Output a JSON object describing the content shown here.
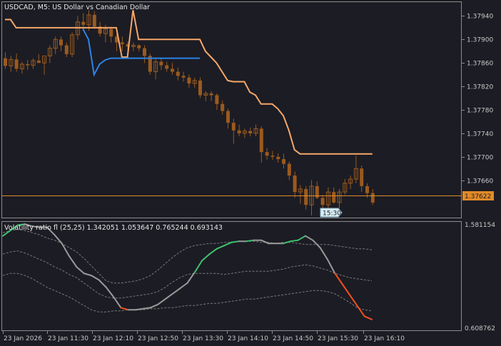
{
  "main_chart": {
    "title": "USDCAD, M5:  US Dollar vs Canadian Dollar",
    "price_labels": [
      "1.37940",
      "1.37900",
      "1.37860",
      "1.37820",
      "1.37780",
      "1.37740",
      "1.37700",
      "1.37660"
    ],
    "current_price": "1.37622",
    "time_tooltip": "15:30"
  },
  "indicator": {
    "title": "Volatility ratio fl (25,25) 1.342051 1.053647 0.765244 0.693143",
    "max_label": "1.581154",
    "min_label": "0.608762"
  },
  "time_axis": {
    "labels": [
      "23 Jan 2026",
      "23 Jan 11:30",
      "23 Jan 12:10",
      "23 Jan 12:50",
      "23 Jan 13:30",
      "23 Jan 14:10",
      "23 Jan 14:50",
      "23 Jan 15:30",
      "23 Jan 16:10"
    ]
  },
  "colors": {
    "background": "#1c1c24",
    "grid": "#5a5a5a",
    "candle": "#9a5a1e",
    "upper_line": "#f5a86a",
    "lower_line": "#2d83e6",
    "price_line": "#e08a28",
    "vol_up": "#3dc36e",
    "vol_down": "#f0501e",
    "vol_flat": "#9a9a9a",
    "vol_band": "#7a7a7a"
  },
  "chart_data": [
    {
      "type": "candlestick",
      "title": "USDCAD, M5:  US Dollar vs Canadian Dollar",
      "ylim": [
        1.376,
        1.3796
      ],
      "candles": [
        {
          "o": 1.37868,
          "h": 1.37878,
          "l": 1.3785,
          "c": 1.37855
        },
        {
          "o": 1.37855,
          "h": 1.37872,
          "l": 1.37845,
          "c": 1.37866
        },
        {
          "o": 1.37866,
          "h": 1.37876,
          "l": 1.37845,
          "c": 1.3785
        },
        {
          "o": 1.3785,
          "h": 1.37862,
          "l": 1.37842,
          "c": 1.37858
        },
        {
          "o": 1.37858,
          "h": 1.37865,
          "l": 1.37848,
          "c": 1.37856
        },
        {
          "o": 1.37856,
          "h": 1.37868,
          "l": 1.3785,
          "c": 1.37864
        },
        {
          "o": 1.37864,
          "h": 1.37875,
          "l": 1.3786,
          "c": 1.3786
        },
        {
          "o": 1.3786,
          "h": 1.3787,
          "l": 1.3784,
          "c": 1.37872
        },
        {
          "o": 1.37872,
          "h": 1.3789,
          "l": 1.3786,
          "c": 1.37885
        },
        {
          "o": 1.37885,
          "h": 1.37905,
          "l": 1.37875,
          "c": 1.379
        },
        {
          "o": 1.379,
          "h": 1.37905,
          "l": 1.3788,
          "c": 1.3789
        },
        {
          "o": 1.3789,
          "h": 1.37895,
          "l": 1.3787,
          "c": 1.37875
        },
        {
          "o": 1.37875,
          "h": 1.37912,
          "l": 1.3787,
          "c": 1.37908
        },
        {
          "o": 1.37908,
          "h": 1.3794,
          "l": 1.379,
          "c": 1.3793
        },
        {
          "o": 1.3793,
          "h": 1.37945,
          "l": 1.37915,
          "c": 1.37925
        },
        {
          "o": 1.37925,
          "h": 1.3795,
          "l": 1.37915,
          "c": 1.37942
        },
        {
          "o": 1.37942,
          "h": 1.37948,
          "l": 1.37918,
          "c": 1.37922
        },
        {
          "o": 1.37922,
          "h": 1.3793,
          "l": 1.37905,
          "c": 1.3791
        },
        {
          "o": 1.3791,
          "h": 1.37925,
          "l": 1.37895,
          "c": 1.37918
        },
        {
          "o": 1.37918,
          "h": 1.37922,
          "l": 1.37895,
          "c": 1.37905
        },
        {
          "o": 1.37905,
          "h": 1.3791,
          "l": 1.3788,
          "c": 1.37895
        },
        {
          "o": 1.37895,
          "h": 1.37905,
          "l": 1.3788,
          "c": 1.37892
        },
        {
          "o": 1.37892,
          "h": 1.37896,
          "l": 1.37878,
          "c": 1.37888
        },
        {
          "o": 1.37888,
          "h": 1.37895,
          "l": 1.3788,
          "c": 1.3789
        },
        {
          "o": 1.3789,
          "h": 1.37892,
          "l": 1.3788,
          "c": 1.37885
        },
        {
          "o": 1.37885,
          "h": 1.3789,
          "l": 1.3786,
          "c": 1.37872
        },
        {
          "o": 1.37872,
          "h": 1.37876,
          "l": 1.3784,
          "c": 1.37845
        },
        {
          "o": 1.37845,
          "h": 1.37868,
          "l": 1.37832,
          "c": 1.37862
        },
        {
          "o": 1.37862,
          "h": 1.37868,
          "l": 1.37848,
          "c": 1.37856
        },
        {
          "o": 1.37856,
          "h": 1.37862,
          "l": 1.37845,
          "c": 1.3785
        },
        {
          "o": 1.3785,
          "h": 1.3786,
          "l": 1.3784,
          "c": 1.37845
        },
        {
          "o": 1.37845,
          "h": 1.37852,
          "l": 1.3783,
          "c": 1.37838
        },
        {
          "o": 1.37838,
          "h": 1.37845,
          "l": 1.37828,
          "c": 1.37835
        },
        {
          "o": 1.37835,
          "h": 1.3784,
          "l": 1.37818,
          "c": 1.37825
        },
        {
          "o": 1.37825,
          "h": 1.37835,
          "l": 1.37818,
          "c": 1.3783
        },
        {
          "o": 1.3783,
          "h": 1.37835,
          "l": 1.378,
          "c": 1.37805
        },
        {
          "o": 1.37805,
          "h": 1.37812,
          "l": 1.37795,
          "c": 1.37808
        },
        {
          "o": 1.37808,
          "h": 1.37812,
          "l": 1.37795,
          "c": 1.37805
        },
        {
          "o": 1.37805,
          "h": 1.37808,
          "l": 1.3778,
          "c": 1.3779
        },
        {
          "o": 1.3779,
          "h": 1.37796,
          "l": 1.37772,
          "c": 1.37778
        },
        {
          "o": 1.37778,
          "h": 1.37782,
          "l": 1.37748,
          "c": 1.37758
        },
        {
          "o": 1.37758,
          "h": 1.37765,
          "l": 1.37722,
          "c": 1.37745
        },
        {
          "o": 1.37745,
          "h": 1.37755,
          "l": 1.37735,
          "c": 1.3774
        },
        {
          "o": 1.3774,
          "h": 1.37748,
          "l": 1.37732,
          "c": 1.37744
        },
        {
          "o": 1.37744,
          "h": 1.3775,
          "l": 1.37735,
          "c": 1.3774
        },
        {
          "o": 1.3774,
          "h": 1.37755,
          "l": 1.37735,
          "c": 1.37748
        },
        {
          "o": 1.37748,
          "h": 1.37752,
          "l": 1.3769,
          "c": 1.37708
        },
        {
          "o": 1.37708,
          "h": 1.37715,
          "l": 1.37695,
          "c": 1.37702
        },
        {
          "o": 1.37702,
          "h": 1.3771,
          "l": 1.37695,
          "c": 1.377
        },
        {
          "o": 1.377,
          "h": 1.37706,
          "l": 1.3769,
          "c": 1.37696
        },
        {
          "o": 1.37696,
          "h": 1.37705,
          "l": 1.3768,
          "c": 1.37688
        },
        {
          "o": 1.37688,
          "h": 1.37692,
          "l": 1.3766,
          "c": 1.37668
        },
        {
          "o": 1.37668,
          "h": 1.37675,
          "l": 1.3763,
          "c": 1.3764
        },
        {
          "o": 1.3764,
          "h": 1.37652,
          "l": 1.3762,
          "c": 1.37645
        },
        {
          "o": 1.37645,
          "h": 1.3765,
          "l": 1.3761,
          "c": 1.37618
        },
        {
          "o": 1.37618,
          "h": 1.3766,
          "l": 1.376,
          "c": 1.3765
        },
        {
          "o": 1.3765,
          "h": 1.37658,
          "l": 1.37628,
          "c": 1.3763
        },
        {
          "o": 1.3763,
          "h": 1.37635,
          "l": 1.3761,
          "c": 1.37618
        },
        {
          "o": 1.37618,
          "h": 1.37648,
          "l": 1.37612,
          "c": 1.3764
        },
        {
          "o": 1.3764,
          "h": 1.37648,
          "l": 1.3762,
          "c": 1.37622
        },
        {
          "o": 1.37622,
          "h": 1.37645,
          "l": 1.37612,
          "c": 1.3764
        },
        {
          "o": 1.3764,
          "h": 1.37662,
          "l": 1.37635,
          "c": 1.37655
        },
        {
          "o": 1.37655,
          "h": 1.37668,
          "l": 1.37645,
          "c": 1.37662
        },
        {
          "o": 1.37662,
          "h": 1.37702,
          "l": 1.37655,
          "c": 1.3768
        },
        {
          "o": 1.3768,
          "h": 1.37685,
          "l": 1.3764,
          "c": 1.3765
        },
        {
          "o": 1.3765,
          "h": 1.37655,
          "l": 1.3763,
          "c": 1.37638
        },
        {
          "o": 1.37638,
          "h": 1.37645,
          "l": 1.37618,
          "c": 1.37622
        }
      ],
      "upper_band": [
        1.37934,
        1.37934,
        1.3792,
        1.3792,
        1.3792,
        1.3792,
        1.3792,
        1.3792,
        1.3792,
        1.3792,
        1.3792,
        1.3792,
        1.3792,
        1.3792,
        1.3792,
        1.3792,
        1.3792,
        1.3792,
        1.3792,
        1.3792,
        1.3792,
        1.3787,
        1.3787,
        1.3795,
        1.379,
        1.379,
        1.379,
        1.379,
        1.379,
        1.379,
        1.379,
        1.379,
        1.379,
        1.379,
        1.379,
        1.379,
        1.3788,
        1.3787,
        1.3786,
        1.37845,
        1.3783,
        1.37828,
        1.37828,
        1.37828,
        1.3781,
        1.37805,
        1.3779,
        1.3779,
        1.3779,
        1.37782,
        1.3777,
        1.37745,
        1.37712,
        1.37705,
        1.37705,
        1.37705,
        1.37705,
        1.37705,
        1.37705,
        1.37705,
        1.37705,
        1.37705,
        1.37705,
        1.37705,
        1.37705,
        1.37705,
        1.37705
      ],
      "lower_band": [
        null,
        null,
        null,
        null,
        null,
        null,
        null,
        null,
        null,
        null,
        null,
        null,
        null,
        null,
        1.37918,
        1.379,
        1.3784,
        1.37858,
        1.37865,
        1.37868,
        1.37868,
        1.37868,
        1.37868,
        1.37868,
        1.37868,
        1.37868,
        1.37868,
        1.37868,
        1.37868,
        1.37868,
        1.37868,
        1.37868,
        1.37868,
        1.37868,
        1.37868,
        1.37868,
        null,
        null,
        null,
        null,
        null,
        null,
        null,
        null,
        null,
        null,
        null,
        null,
        null,
        null,
        null,
        null,
        null,
        null,
        null,
        null,
        null,
        null,
        null,
        null,
        null,
        null,
        null,
        null,
        null,
        null,
        null
      ]
    },
    {
      "type": "line",
      "title": "Volatility ratio fl (25,25) 1.342051 1.053647 0.765244 0.693143",
      "ylim": [
        0.608762,
        1.581154
      ],
      "ratio": [
        1.47,
        1.52,
        1.57,
        1.58,
        1.56,
        1.55,
        1.55,
        1.48,
        1.4,
        1.28,
        1.18,
        1.12,
        1.1,
        1.06,
        0.99,
        0.9,
        0.8,
        0.78,
        0.78,
        0.79,
        0.8,
        0.83,
        0.88,
        0.93,
        0.98,
        1.03,
        1.13,
        1.24,
        1.3,
        1.35,
        1.38,
        1.41,
        1.42,
        1.42,
        1.43,
        1.43,
        1.4,
        1.4,
        1.4,
        1.42,
        1.43,
        1.47,
        1.43,
        1.36,
        1.25,
        1.12,
        1.02,
        0.92,
        0.82,
        0.72,
        0.69
      ],
      "upper_band": [
        1.5,
        1.52,
        1.53,
        1.52,
        1.5,
        1.48,
        1.45,
        1.43,
        1.4,
        1.36,
        1.32,
        1.26,
        1.19,
        1.12,
        1.05,
        1.03,
        1.03,
        1.04,
        1.05,
        1.07,
        1.1,
        1.15,
        1.21,
        1.27,
        1.32,
        1.36,
        1.38,
        1.39,
        1.4,
        1.4,
        1.41,
        1.41,
        1.42,
        1.42,
        1.42,
        1.41,
        1.41,
        1.4,
        1.41,
        1.41,
        1.4,
        1.39,
        1.39,
        1.39,
        1.39,
        1.38,
        1.37,
        1.36,
        1.35,
        1.35,
        1.34
      ],
      "mid_band": [
        1.3,
        1.32,
        1.33,
        1.31,
        1.28,
        1.25,
        1.22,
        1.18,
        1.15,
        1.11,
        1.08,
        1.03,
        0.98,
        0.93,
        0.9,
        0.89,
        0.89,
        0.9,
        0.91,
        0.92,
        0.93,
        0.95,
        0.99,
        1.04,
        1.08,
        1.11,
        1.12,
        1.12,
        1.12,
        1.12,
        1.11,
        1.12,
        1.13,
        1.14,
        1.14,
        1.14,
        1.14,
        1.15,
        1.16,
        1.18,
        1.19,
        1.2,
        1.19,
        1.17,
        1.15,
        1.12,
        1.1,
        1.08,
        1.07,
        1.06,
        1.05
      ],
      "lower_band": [
        1.1,
        1.12,
        1.12,
        1.1,
        1.07,
        1.03,
        0.99,
        0.96,
        0.93,
        0.9,
        0.86,
        0.82,
        0.78,
        0.76,
        0.76,
        0.77,
        0.77,
        0.78,
        0.78,
        0.78,
        0.79,
        0.79,
        0.8,
        0.8,
        0.81,
        0.82,
        0.82,
        0.83,
        0.84,
        0.84,
        0.85,
        0.86,
        0.87,
        0.88,
        0.88,
        0.89,
        0.9,
        0.91,
        0.92,
        0.93,
        0.94,
        0.95,
        0.96,
        0.96,
        0.95,
        0.93,
        0.89,
        0.85,
        0.8,
        0.78,
        0.77
      ]
    }
  ]
}
